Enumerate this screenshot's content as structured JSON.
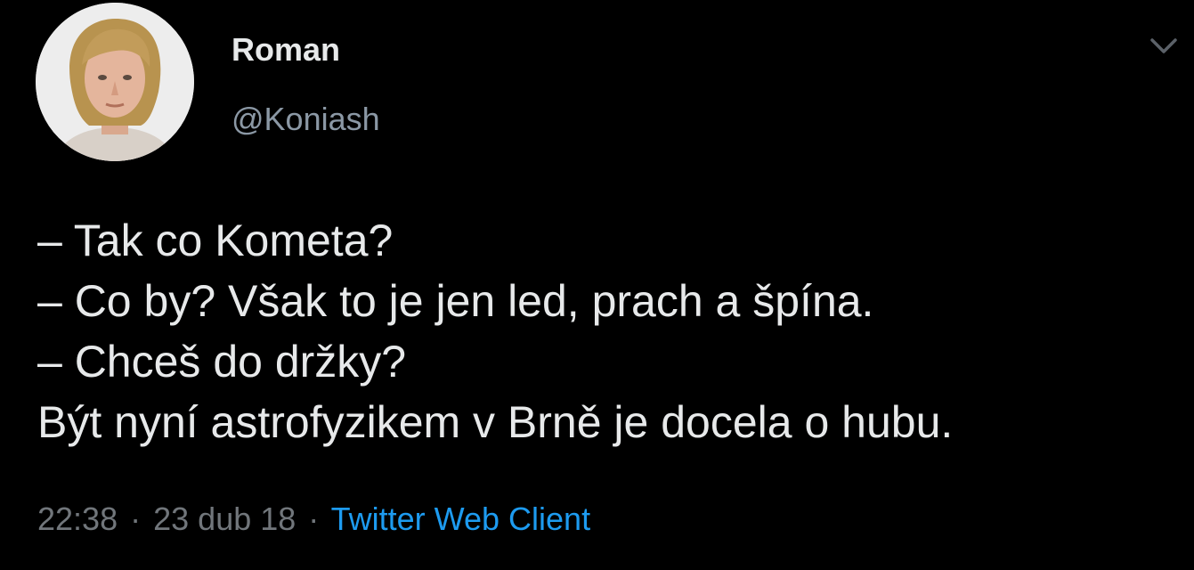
{
  "author": {
    "name": "Roman",
    "handle": "@Koniash",
    "avatar_icon": "profile-photo"
  },
  "tweet": {
    "lines": [
      "– Tak co Kometa?",
      "– Co by? Však to je jen led, prach a špína.",
      "– Chceš do držky?",
      "Být nyní astrofyzikem v Brně je docela o hubu."
    ]
  },
  "meta": {
    "time": "22:38",
    "separator": "·",
    "date": "23 dub 18",
    "client": "Twitter Web Client"
  },
  "menu": {
    "icon": "chevron-down-icon"
  },
  "colors": {
    "background": "#000000",
    "text": "#e7e9ea",
    "secondary": "#71767b",
    "link": "#1d9bf0"
  }
}
